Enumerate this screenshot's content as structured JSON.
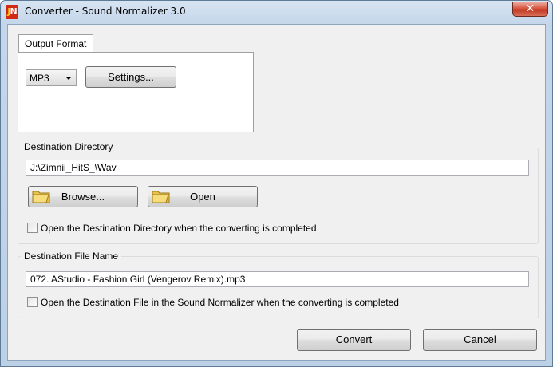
{
  "window": {
    "title": "Converter - Sound Normalizer 3.0",
    "close_glyph": "✕",
    "icon": "app-icon"
  },
  "output_format": {
    "tab_label": "Output Format",
    "format_value": "MP3",
    "settings_label": "Settings..."
  },
  "destination_directory": {
    "group_label": "Destination Directory",
    "path_value": "J:\\Zimnii_HitS_\\Wav",
    "browse_label": "Browse...",
    "open_label": "Open",
    "browse_icon": "folder-icon",
    "open_icon": "folder-icon",
    "checkbox_label": "Open the Destination Directory when the converting is completed",
    "checkbox_checked": false
  },
  "destination_file": {
    "group_label": "Destination File Name",
    "file_value": "072. AStudio - Fashion Girl (Vengerov Remix).mp3",
    "checkbox_label": "Open the Destination File in the Sound Normalizer when the converting is completed",
    "checkbox_checked": false
  },
  "actions": {
    "convert_label": "Convert",
    "cancel_label": "Cancel"
  },
  "colors": {
    "close_button": "#c13a22",
    "title_bar": "#c4d6ea",
    "dialog_bg": "#f0f0f0"
  }
}
